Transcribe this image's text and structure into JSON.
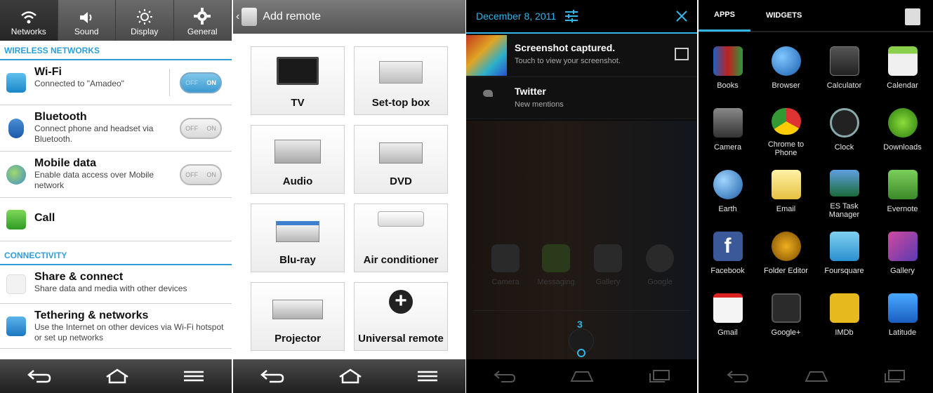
{
  "settings": {
    "tabs": [
      {
        "label": "Networks"
      },
      {
        "label": "Sound"
      },
      {
        "label": "Display"
      },
      {
        "label": "General"
      }
    ],
    "wireless_header": "WIRELESS NETWORKS",
    "wifi": {
      "title": "Wi-Fi",
      "subtitle": "Connected to \"Amadeo\"",
      "toggle_off": "OFF",
      "toggle_on": "ON",
      "state": "on"
    },
    "bluetooth": {
      "title": "Bluetooth",
      "subtitle": "Connect phone and headset via Bluetooth.",
      "toggle_off": "OFF",
      "toggle_on": "ON",
      "state": "off"
    },
    "mobile": {
      "title": "Mobile data",
      "subtitle": "Enable data access over Mobile network",
      "toggle_off": "OFF",
      "toggle_on": "ON",
      "state": "off"
    },
    "call": {
      "title": "Call"
    },
    "connectivity_header": "CONNECTIVITY",
    "share": {
      "title": "Share & connect",
      "subtitle": "Share data and media with other devices"
    },
    "tethering": {
      "title": "Tethering & networks",
      "subtitle": "Use the Internet on other devices via Wi-Fi hotspot or set up networks"
    }
  },
  "remote": {
    "title": "Add remote",
    "tiles": [
      {
        "label": "TV"
      },
      {
        "label": "Set-top box"
      },
      {
        "label": "Audio"
      },
      {
        "label": "DVD"
      },
      {
        "label": "Blu-ray"
      },
      {
        "label": "Air conditioner"
      },
      {
        "label": "Projector"
      },
      {
        "label": "Universal remote"
      }
    ]
  },
  "notifications": {
    "date": "December 8, 2011",
    "items": [
      {
        "title": "Screenshot captured.",
        "subtitle": "Touch to view your screenshot."
      },
      {
        "title": "Twitter",
        "subtitle": "New mentions"
      }
    ],
    "dim_apps": [
      {
        "label": "Camera"
      },
      {
        "label": "Messaging"
      },
      {
        "label": "Gallery"
      },
      {
        "label": "Google"
      }
    ],
    "page_count": "3"
  },
  "drawer": {
    "tabs": [
      {
        "label": "APPS"
      },
      {
        "label": "WIDGETS"
      }
    ],
    "apps": [
      {
        "label": "Books"
      },
      {
        "label": "Browser"
      },
      {
        "label": "Calculator"
      },
      {
        "label": "Calendar"
      },
      {
        "label": "Camera"
      },
      {
        "label": "Chrome to Phone"
      },
      {
        "label": "Clock"
      },
      {
        "label": "Downloads"
      },
      {
        "label": "Earth"
      },
      {
        "label": "Email"
      },
      {
        "label": "ES Task Manager"
      },
      {
        "label": "Evernote"
      },
      {
        "label": "Facebook"
      },
      {
        "label": "Folder Editor"
      },
      {
        "label": "Foursquare"
      },
      {
        "label": "Gallery"
      },
      {
        "label": "Gmail"
      },
      {
        "label": "Google+"
      },
      {
        "label": "IMDb"
      },
      {
        "label": "Latitude"
      }
    ]
  },
  "colors": {
    "accent": "#33b5e5",
    "lg_blue": "#2f9fd8"
  }
}
